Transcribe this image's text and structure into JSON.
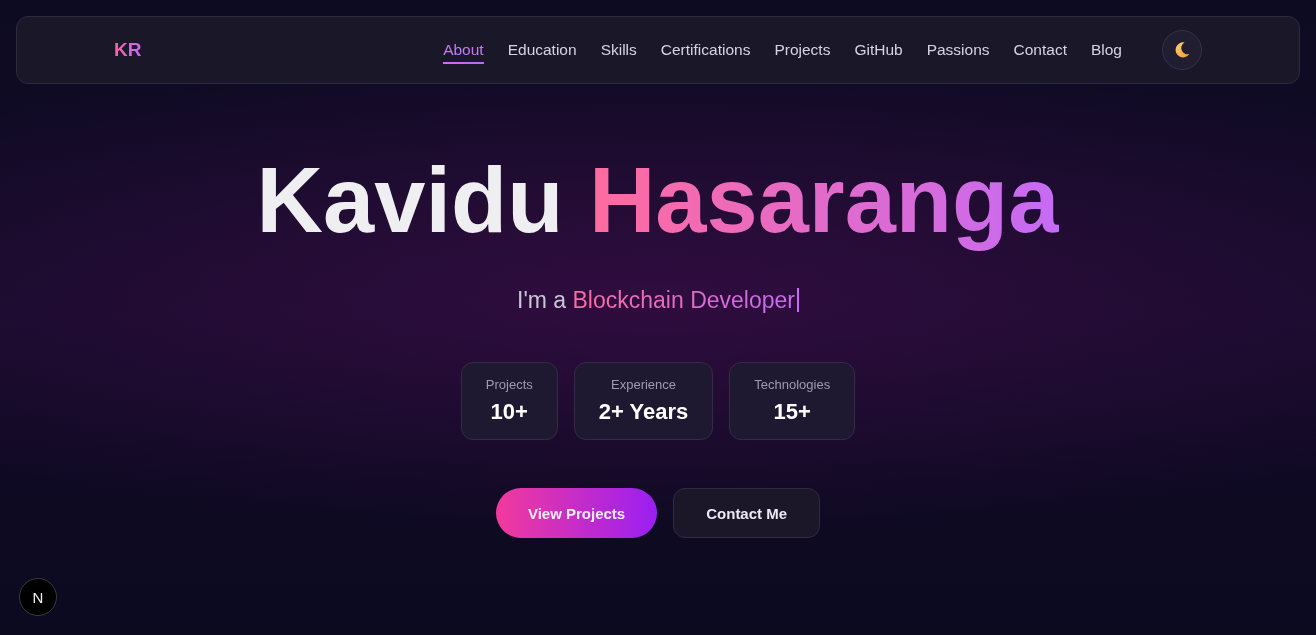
{
  "nav": {
    "logo": "KR",
    "links": [
      {
        "label": "About",
        "selected": true
      },
      {
        "label": "Education",
        "selected": false
      },
      {
        "label": "Skills",
        "selected": false
      },
      {
        "label": "Certifications",
        "selected": false
      },
      {
        "label": "Projects",
        "selected": false
      },
      {
        "label": "GitHub",
        "selected": false
      },
      {
        "label": "Passions",
        "selected": false
      },
      {
        "label": "Contact",
        "selected": false
      },
      {
        "label": "Blog",
        "selected": false
      }
    ]
  },
  "hero": {
    "name": {
      "first": "Kavidu",
      "highlight": "Hasaranga"
    },
    "tagline": {
      "prefix": "I'm a",
      "role": "Blockchain Developer"
    },
    "stats": [
      {
        "label": "Projects",
        "value": "10+"
      },
      {
        "label": "Experience",
        "value": "2+ Years"
      },
      {
        "label": "Technologies",
        "value": "15+"
      }
    ],
    "buttons": [
      {
        "label": "View Projects",
        "kind": "primary"
      },
      {
        "label": "Contact Me",
        "kind": "secondary"
      }
    ]
  },
  "dev_badge": {
    "label": "N"
  }
}
